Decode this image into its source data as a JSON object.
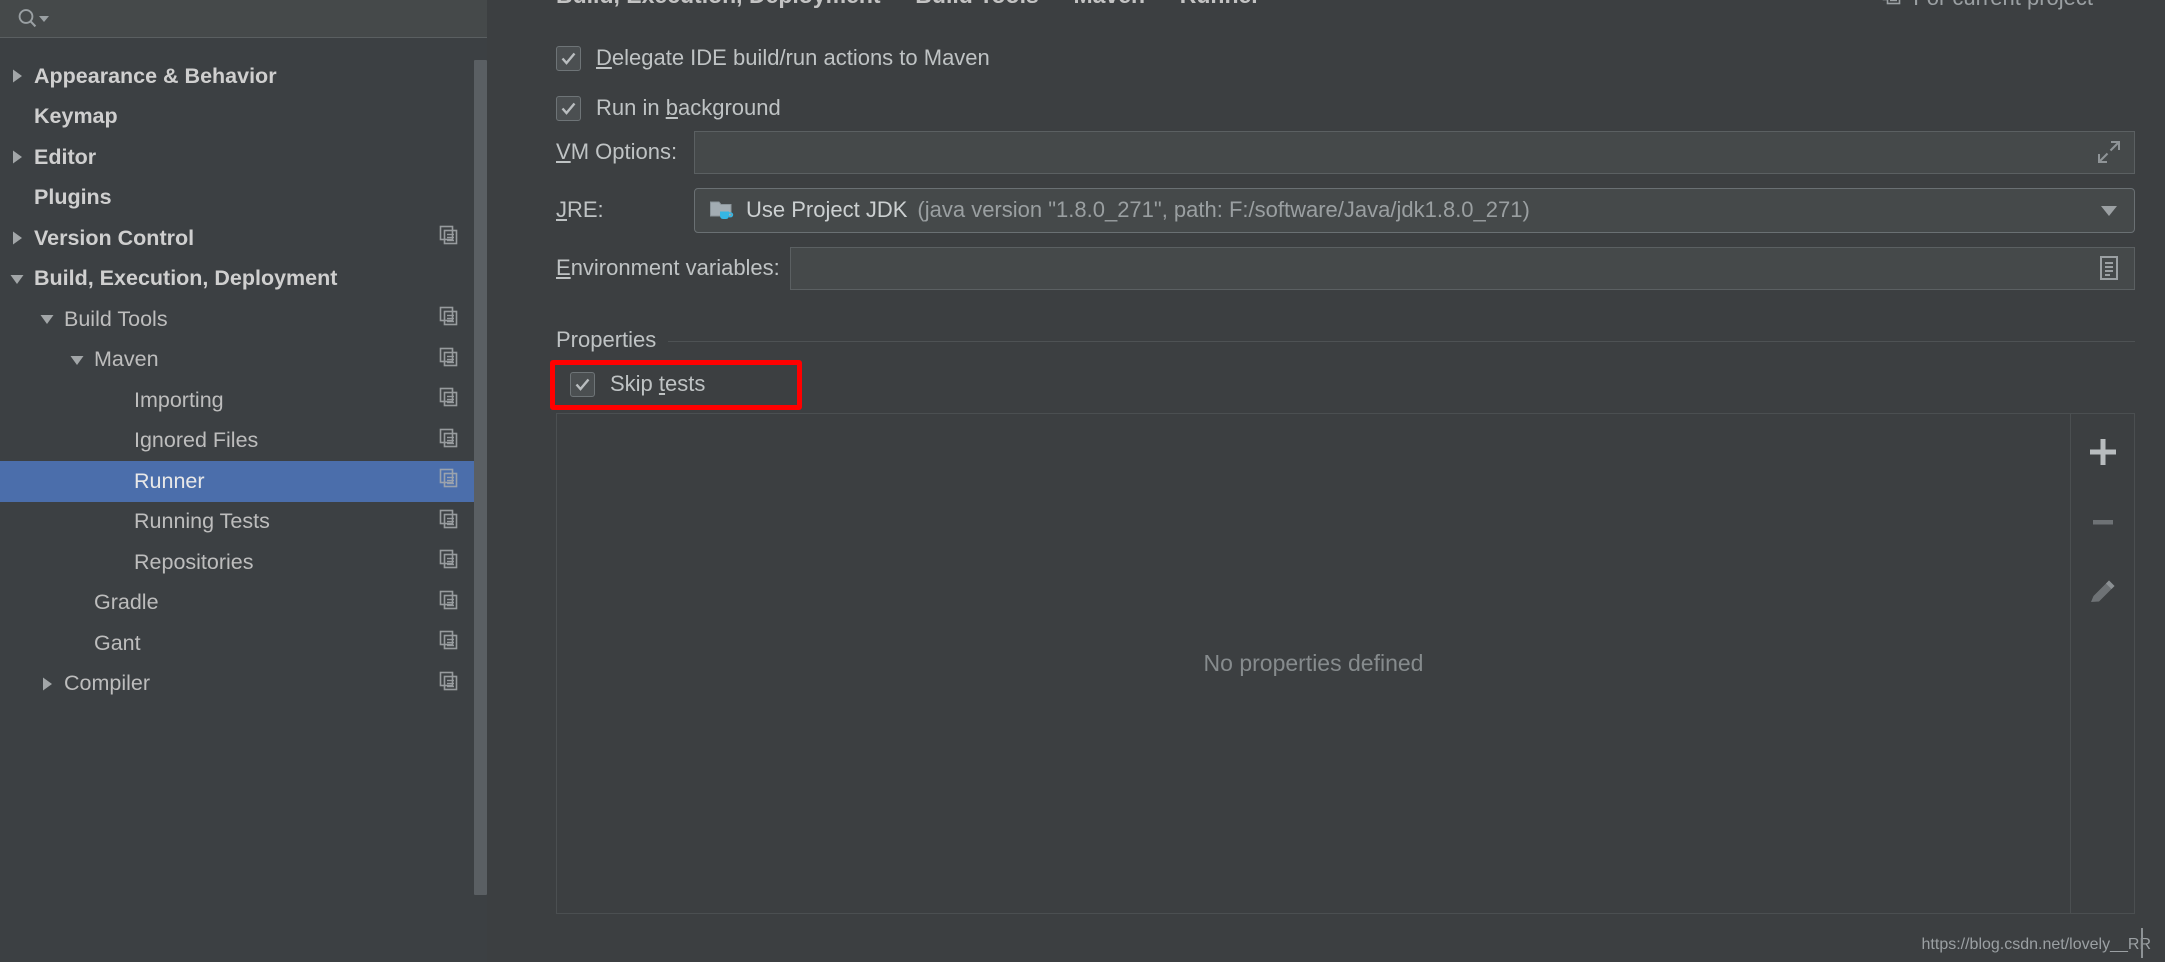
{
  "search": {
    "placeholder": "",
    "value": "",
    "icon": "search-icon",
    "dropdown_icon": "chevron-down-icon"
  },
  "sidebar": {
    "items": [
      {
        "label": "Appearance & Behavior",
        "depth": 0,
        "arrow": "right",
        "bold": true,
        "copy": false,
        "selected": false
      },
      {
        "label": "Keymap",
        "depth": 0,
        "arrow": "none",
        "bold": true,
        "copy": false,
        "selected": false
      },
      {
        "label": "Editor",
        "depth": 0,
        "arrow": "right",
        "bold": true,
        "copy": false,
        "selected": false
      },
      {
        "label": "Plugins",
        "depth": 0,
        "arrow": "none",
        "bold": true,
        "copy": false,
        "selected": false
      },
      {
        "label": "Version Control",
        "depth": 0,
        "arrow": "right",
        "bold": true,
        "copy": true,
        "selected": false
      },
      {
        "label": "Build, Execution, Deployment",
        "depth": 0,
        "arrow": "down",
        "bold": true,
        "copy": false,
        "selected": false
      },
      {
        "label": "Build Tools",
        "depth": 1,
        "arrow": "down",
        "bold": false,
        "copy": true,
        "selected": false
      },
      {
        "label": "Maven",
        "depth": 2,
        "arrow": "down",
        "bold": false,
        "copy": true,
        "selected": false
      },
      {
        "label": "Importing",
        "depth": 3,
        "arrow": "none",
        "bold": false,
        "copy": true,
        "selected": false
      },
      {
        "label": "Ignored Files",
        "depth": 3,
        "arrow": "none",
        "bold": false,
        "copy": true,
        "selected": false
      },
      {
        "label": "Runner",
        "depth": 3,
        "arrow": "none",
        "bold": false,
        "copy": true,
        "selected": true
      },
      {
        "label": "Running Tests",
        "depth": 3,
        "arrow": "none",
        "bold": false,
        "copy": true,
        "selected": false
      },
      {
        "label": "Repositories",
        "depth": 3,
        "arrow": "none",
        "bold": false,
        "copy": true,
        "selected": false
      },
      {
        "label": "Gradle",
        "depth": 2,
        "arrow": "none",
        "bold": false,
        "copy": true,
        "selected": false
      },
      {
        "label": "Gant",
        "depth": 2,
        "arrow": "none",
        "bold": false,
        "copy": true,
        "selected": false
      },
      {
        "label": "Compiler",
        "depth": 1,
        "arrow": "right",
        "bold": false,
        "copy": true,
        "selected": false
      }
    ]
  },
  "breadcrumb": {
    "items": [
      "Build, Execution, Deployment",
      "Build Tools",
      "Maven",
      "Runner"
    ],
    "separator": "›"
  },
  "for_project": {
    "label": "For current project",
    "icon": "copy-icon"
  },
  "checkboxes": {
    "delegate": {
      "pre": "",
      "mnemonic": "D",
      "post": "elegate IDE build/run actions to Maven",
      "checked": true
    },
    "background": {
      "pre": "Run in ",
      "mnemonic": "b",
      "post": "ackground",
      "checked": true
    }
  },
  "fields": {
    "vm_options": {
      "label_mnemonic": "V",
      "label_rest": "M Options:",
      "value": "",
      "icon": "expand-icon"
    },
    "jre": {
      "label_mnemonic": "J",
      "label_rest": "RE:",
      "icon": "java-folder-icon",
      "value_main": "Use Project JDK",
      "value_detail": "(java version \"1.8.0_271\", path: F:/software/Java/jdk1.8.0_271)",
      "dropdown_icon": "chevron-down-icon"
    },
    "env_vars": {
      "label_mnemonic": "E",
      "label_rest": "nvironment variables:",
      "value": "",
      "icon": "list-browse-icon"
    }
  },
  "properties": {
    "group_title": "Properties",
    "skip_tests": {
      "pre": "Skip ",
      "mnemonic": "t",
      "post": "ests",
      "checked": true
    },
    "empty_text": "No properties defined",
    "toolbar": [
      {
        "name": "add-property-button",
        "icon": "plus-icon",
        "label": "+"
      },
      {
        "name": "remove-property-button",
        "icon": "minus-icon",
        "label": "–"
      },
      {
        "name": "edit-property-button",
        "icon": "pencil-icon",
        "label": ""
      }
    ]
  },
  "annotation": {
    "color": "#ff0000",
    "target": "skip-tests-checkbox"
  },
  "watermark": {
    "text": "https://blog.csdn.net/lovely__RR"
  },
  "colors": {
    "background": "#3c3f41",
    "sidebar": "#3c4043",
    "selection": "#4b6eab",
    "field": "#45494a",
    "text": "#bfc3c4",
    "dim_text": "#9a9fa1",
    "accent_red": "#ff0000"
  }
}
